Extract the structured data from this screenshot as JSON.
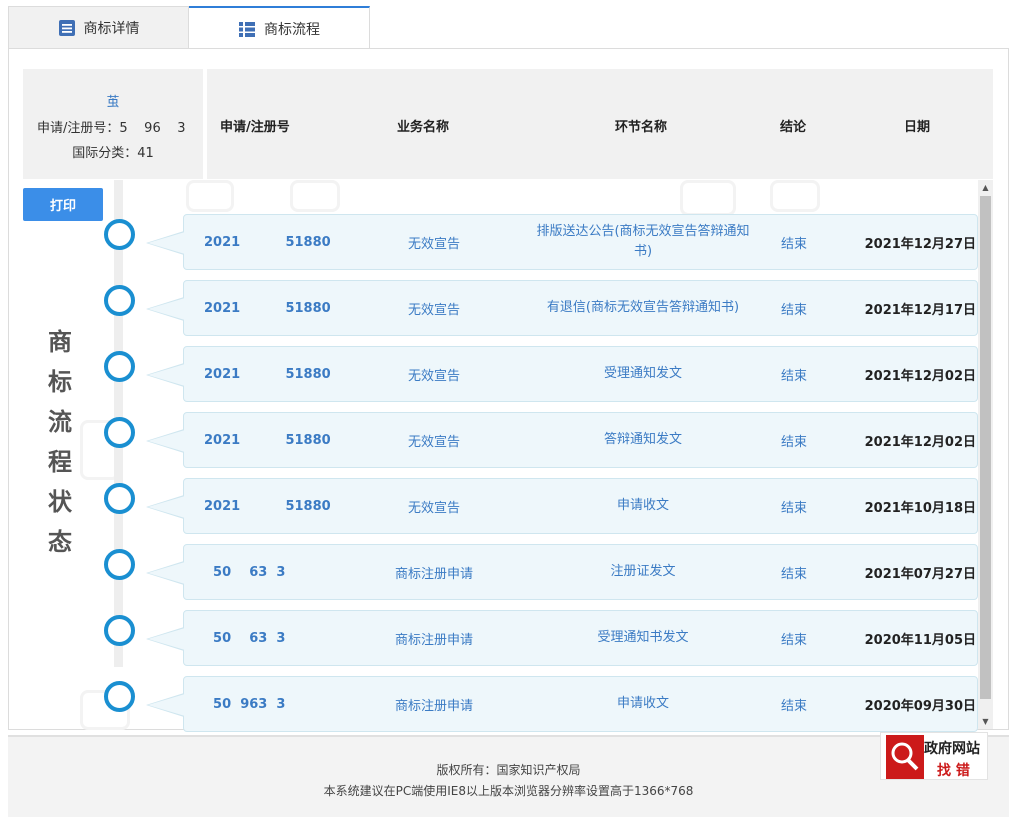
{
  "tabs": [
    {
      "label": "商标详情",
      "icon": "document-list-icon",
      "active": false
    },
    {
      "label": "商标流程",
      "icon": "grid-list-icon",
      "active": true
    }
  ],
  "info": {
    "mark_name": "茧",
    "app_no_line": "申请/注册号：5    96    3",
    "class_line": "国际分类：41"
  },
  "table_header": {
    "app_no": "申请/注册号",
    "business": "业务名称",
    "step": "环节名称",
    "result": "结论",
    "date": "日期"
  },
  "print_label": "打印",
  "vertical_title": [
    "商",
    "标",
    "流",
    "程",
    "状",
    "态"
  ],
  "rows": [
    {
      "app_no": "2021          51880",
      "business": "无效宣告",
      "step": "排版送达公告(商标无效宣告答辩通知书)",
      "result": "结束",
      "date": "2021年12月27日"
    },
    {
      "app_no": "2021          51880",
      "business": "无效宣告",
      "step": "有退信(商标无效宣告答辩通知书)",
      "result": "结束",
      "date": "2021年12月17日"
    },
    {
      "app_no": "2021          51880",
      "business": "无效宣告",
      "step": "受理通知发文",
      "result": "结束",
      "date": "2021年12月02日"
    },
    {
      "app_no": "2021          51880",
      "business": "无效宣告",
      "step": "答辩通知发文",
      "result": "结束",
      "date": "2021年12月02日"
    },
    {
      "app_no": "2021          51880",
      "business": "无效宣告",
      "step": "申请收文",
      "result": "结束",
      "date": "2021年10月18日"
    },
    {
      "app_no": "  50    63  3",
      "business": "商标注册申请",
      "step": "注册证发文",
      "result": "结束",
      "date": "2021年07月27日"
    },
    {
      "app_no": "  50    63  3",
      "business": "商标注册申请",
      "step": "受理通知书发文",
      "result": "结束",
      "date": "2020年11月05日"
    },
    {
      "app_no": "  50  963  3",
      "business": "商标注册申请",
      "step": "申请收文",
      "result": "结束",
      "date": "2020年09月30日"
    }
  ],
  "footer": {
    "copyright": "版权所有：国家知识产权局",
    "advice": "本系统建议在PC端使用IE8以上版本浏览器分辨率设置高于1366*768"
  },
  "gov_badge": {
    "line1": "政府网站",
    "line2": "找 错"
  },
  "colors": {
    "accent": "#1a8fd1",
    "link_text": "#3b7bc4",
    "button": "#3b8ee8",
    "badge_red": "#cc1a1a"
  }
}
